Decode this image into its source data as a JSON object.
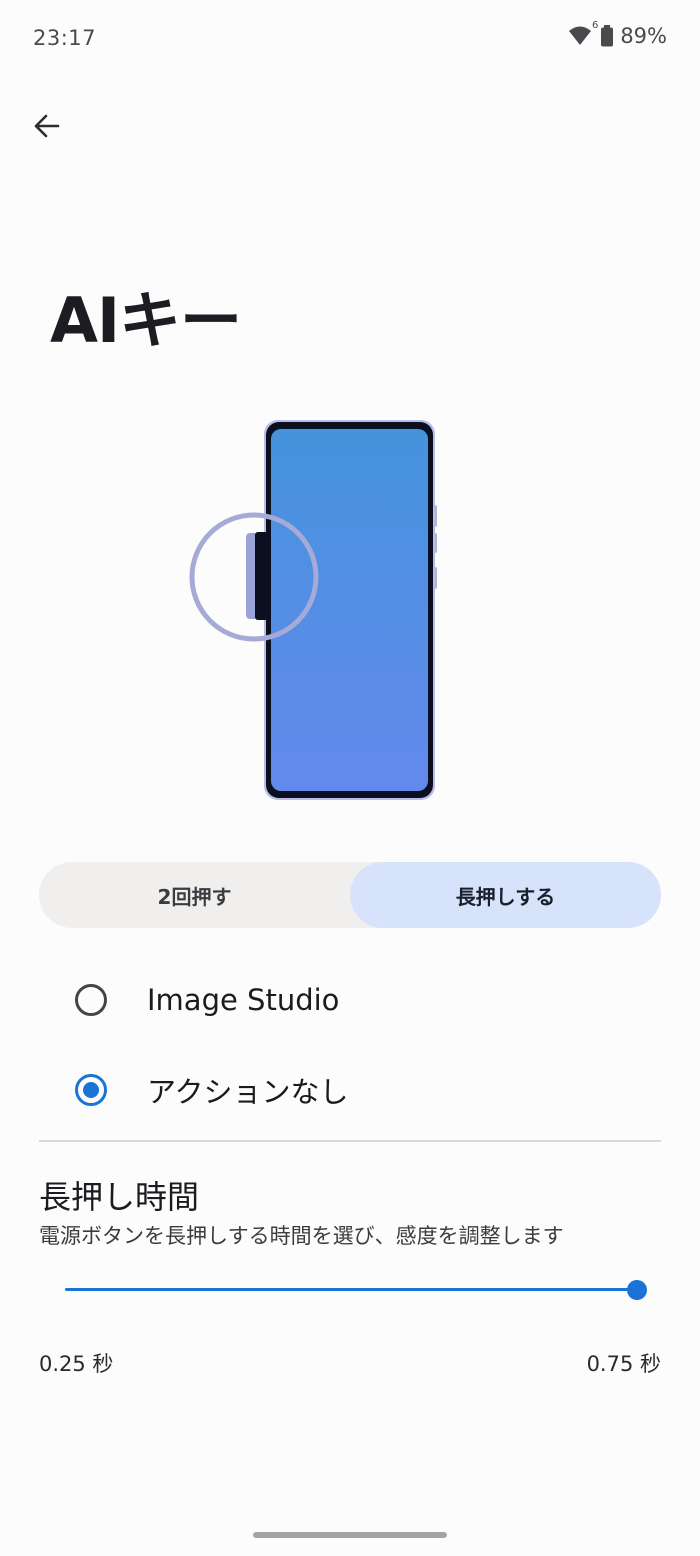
{
  "status_bar": {
    "time": "23:17",
    "battery_percent": "89%",
    "wifi_badge": "6",
    "icons": [
      "wifi-icon",
      "battery-icon"
    ]
  },
  "header": {
    "back_icon": "arrow-back-icon",
    "title": "AIキー"
  },
  "tabs": [
    {
      "label": "2回押す",
      "selected": false
    },
    {
      "label": "長押しする",
      "selected": true
    }
  ],
  "options": [
    {
      "label": "Image Studio",
      "checked": false
    },
    {
      "label": "アクションなし",
      "checked": true
    }
  ],
  "press_duration": {
    "title": "長押し時間",
    "description": "電源ボタンを長押しする時間を選び、感度を調整します",
    "min_label": "0.25 秒",
    "max_label": "0.75 秒",
    "min_value": 0.25,
    "max_value": 0.75,
    "value": 0.75
  },
  "colors": {
    "accent": "#1a73d6",
    "selected_tab": "#d6e3fb",
    "tab_background": "#f1efee",
    "phone_screen_top": "#4593dc",
    "phone_screen_bottom": "#6389ed"
  }
}
